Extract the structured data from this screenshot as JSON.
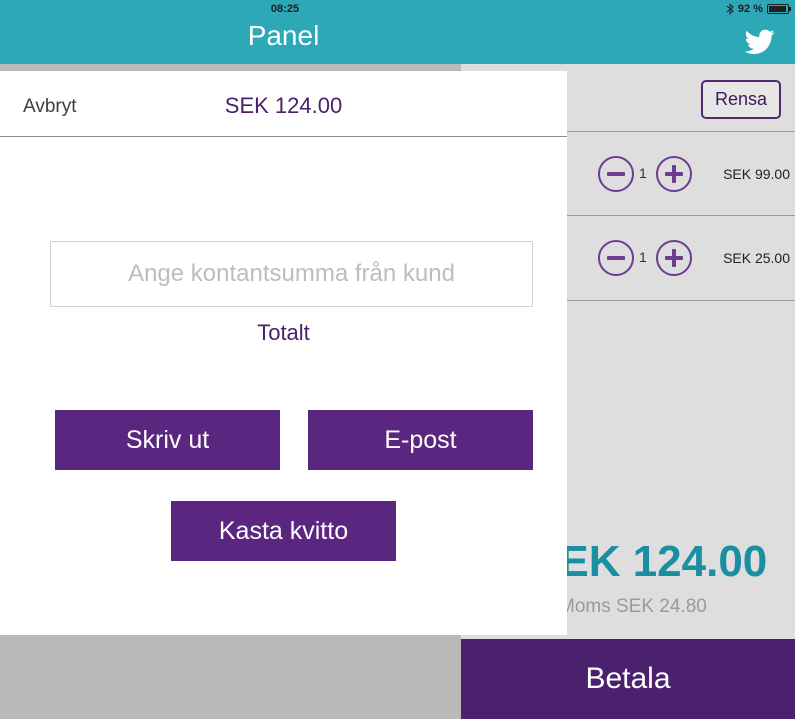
{
  "status_bar": {
    "time": "08:25",
    "battery": "92 %",
    "battery_level": 0.92,
    "bluetooth_icon": "bluetooth-icon",
    "battery_icon": "battery-icon"
  },
  "header": {
    "title": "Panel",
    "share_icon": "twitter-icon",
    "color": "#2da8b7"
  },
  "cart": {
    "clear_label": "Rensa",
    "items": [
      {
        "quantity": "1",
        "price": "SEK 99.00"
      },
      {
        "quantity": "1",
        "price": "SEK 25.00"
      }
    ],
    "total": "SEK 124.00",
    "vat": "Moms SEK 24.80",
    "pay_label": "Betala",
    "accent": "#4b206c"
  },
  "modal": {
    "cancel_label": "Avbryt",
    "amount": "SEK 124.00",
    "cash_placeholder": "Ange kontantsumma från kund",
    "cash_value": "",
    "total_label": "Totalt",
    "print_label": "Skriv ut",
    "email_label": "E-post",
    "discard_label": "Kasta kvitto"
  }
}
